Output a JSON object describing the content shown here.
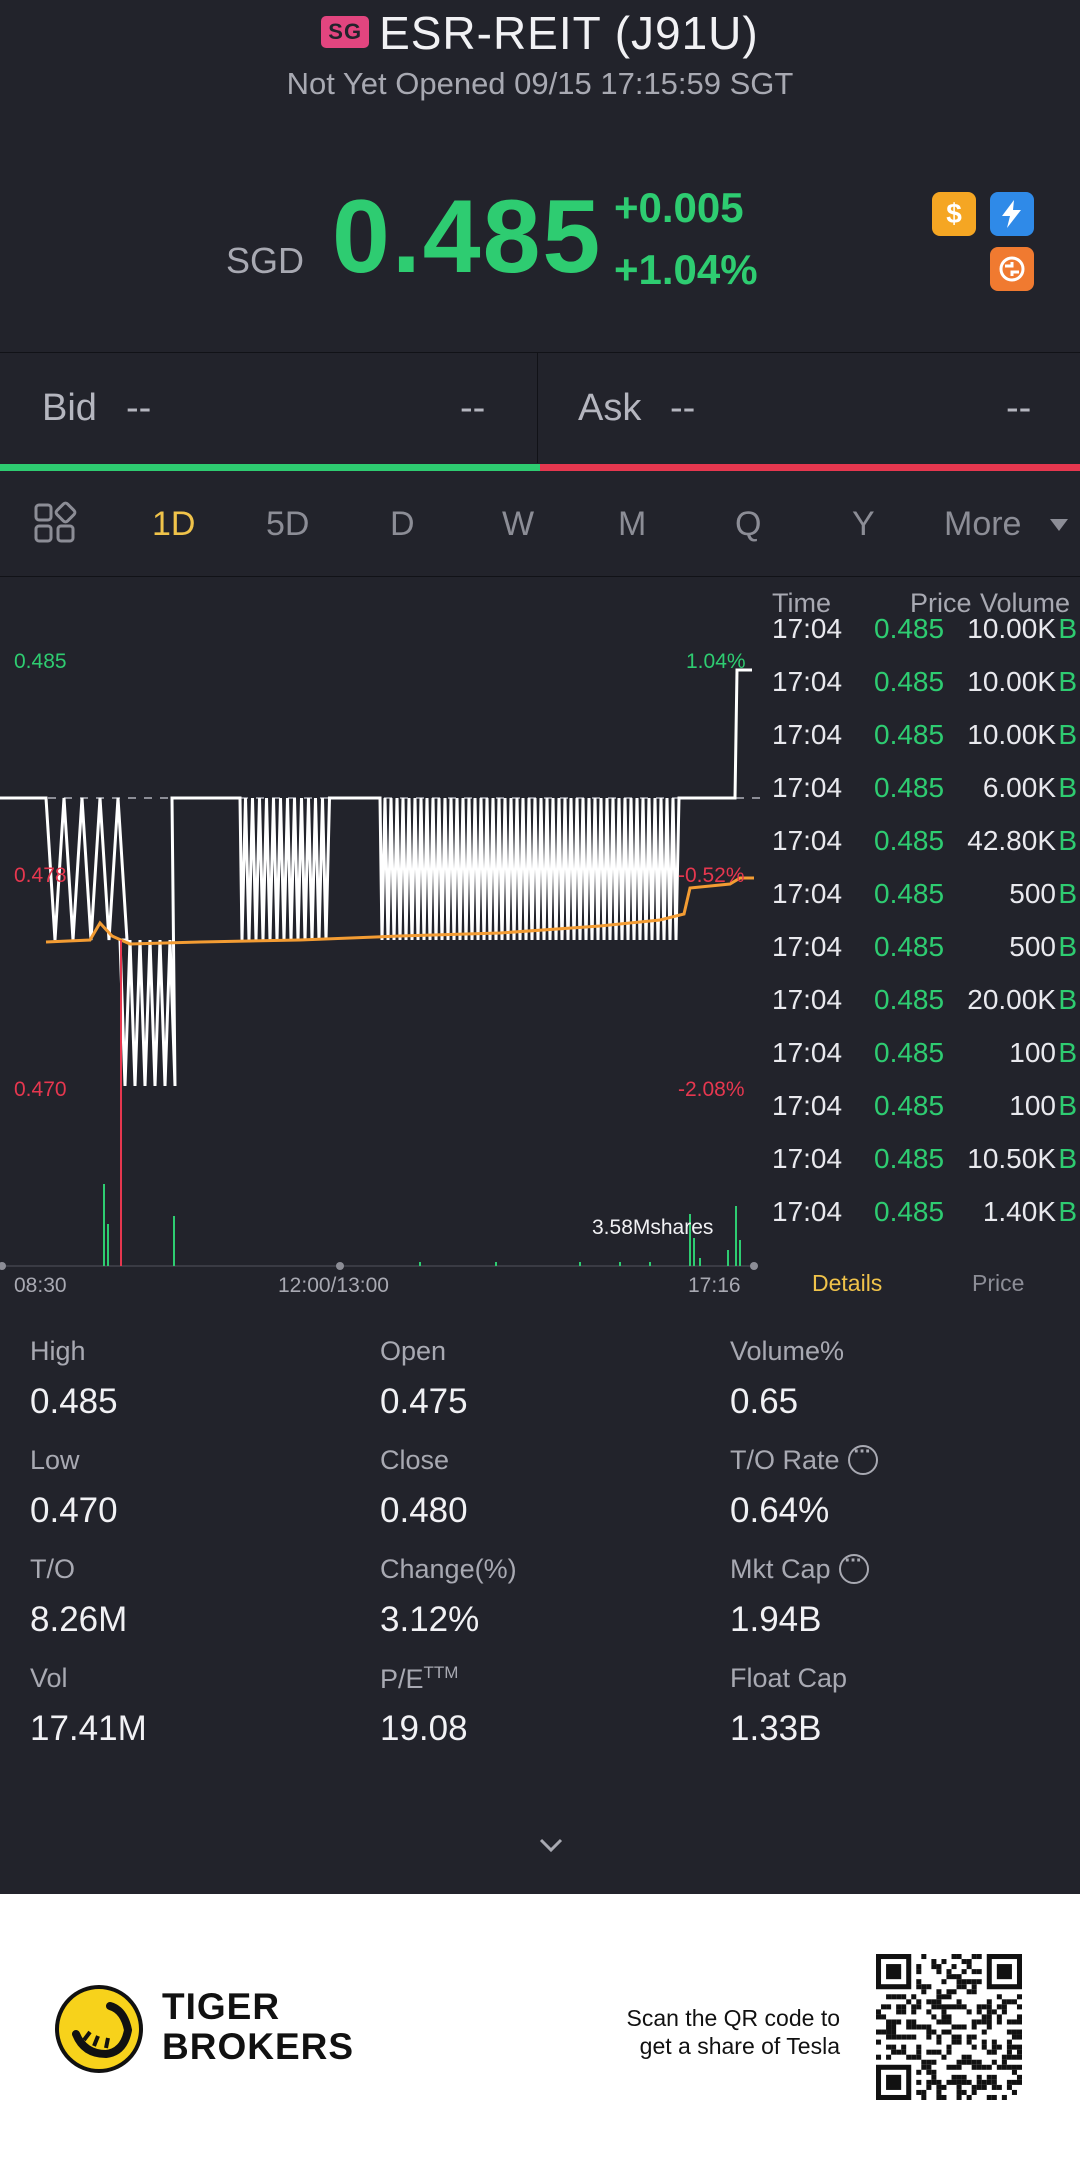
{
  "header": {
    "market_badge": "SG",
    "title": "ESR-REIT (J91U)",
    "status": "Not Yet Opened 09/15 17:15:59 SGT",
    "currency": "SGD",
    "price": "0.485",
    "change": "+0.005",
    "change_pct": "+1.04%",
    "icons": [
      "dollar-icon",
      "lightning-icon",
      "swap-icon"
    ]
  },
  "quote": {
    "bid_label": "Bid",
    "bid_price": "--",
    "bid_size": "--",
    "ask_label": "Ask",
    "ask_price": "--",
    "ask_size": "--"
  },
  "tabs": {
    "items": [
      "1D",
      "5D",
      "D",
      "W",
      "M",
      "Q",
      "Y"
    ],
    "more": "More",
    "active": "1D"
  },
  "chart": {
    "price_high": "0.485",
    "pct_high": "1.04%",
    "price_mid": "0.478",
    "pct_mid": "-0.52%",
    "price_low": "0.470",
    "pct_low": "-2.08%",
    "volume_label": "3.58Mshares",
    "x_start": "08:30",
    "x_mid": "12:00/13:00",
    "x_end": "17:16",
    "colors": {
      "up": "#2ecc71",
      "down": "#e6374f",
      "price_line": "#ffffff",
      "avg_line": "#f39c33"
    }
  },
  "trades": {
    "headers": {
      "time": "Time",
      "price": "Price",
      "volume": "Volume"
    },
    "rows": [
      {
        "time": "17:04",
        "price": "0.485",
        "volume": "10.00K",
        "side": "B"
      },
      {
        "time": "17:04",
        "price": "0.485",
        "volume": "10.00K",
        "side": "B"
      },
      {
        "time": "17:04",
        "price": "0.485",
        "volume": "10.00K",
        "side": "B"
      },
      {
        "time": "17:04",
        "price": "0.485",
        "volume": "6.00K",
        "side": "B"
      },
      {
        "time": "17:04",
        "price": "0.485",
        "volume": "42.80K",
        "side": "B"
      },
      {
        "time": "17:04",
        "price": "0.485",
        "volume": "500",
        "side": "B"
      },
      {
        "time": "17:04",
        "price": "0.485",
        "volume": "500",
        "side": "B"
      },
      {
        "time": "17:04",
        "price": "0.485",
        "volume": "20.00K",
        "side": "B"
      },
      {
        "time": "17:04",
        "price": "0.485",
        "volume": "100",
        "side": "B"
      },
      {
        "time": "17:04",
        "price": "0.485",
        "volume": "100",
        "side": "B"
      },
      {
        "time": "17:04",
        "price": "0.485",
        "volume": "10.50K",
        "side": "B"
      },
      {
        "time": "17:04",
        "price": "0.485",
        "volume": "1.40K",
        "side": "B"
      }
    ],
    "tab_details": "Details",
    "tab_price": "Price"
  },
  "stats": {
    "high_label": "High",
    "high": "0.485",
    "open_label": "Open",
    "open": "0.475",
    "volpct_label": "Volume%",
    "volpct": "0.65",
    "low_label": "Low",
    "low": "0.470",
    "close_label": "Close",
    "close": "0.480",
    "torate_label": "T/O Rate",
    "torate": "0.64%",
    "to_label": "T/O",
    "to": "8.26M",
    "changepct_label": "Change(%)",
    "changepct": "3.12%",
    "mktcap_label": "Mkt Cap",
    "mktcap": "1.94B",
    "vol_label": "Vol",
    "vol": "17.41M",
    "pe_label": "P/E",
    "pe_sup": "TTM",
    "pe": "19.08",
    "floatcap_label": "Float Cap",
    "floatcap": "1.33B"
  },
  "footer": {
    "brand_line1": "TIGER",
    "brand_line2": "BROKERS",
    "scan_line1": "Scan the QR code to",
    "scan_line2": "get a share of Tesla"
  }
}
